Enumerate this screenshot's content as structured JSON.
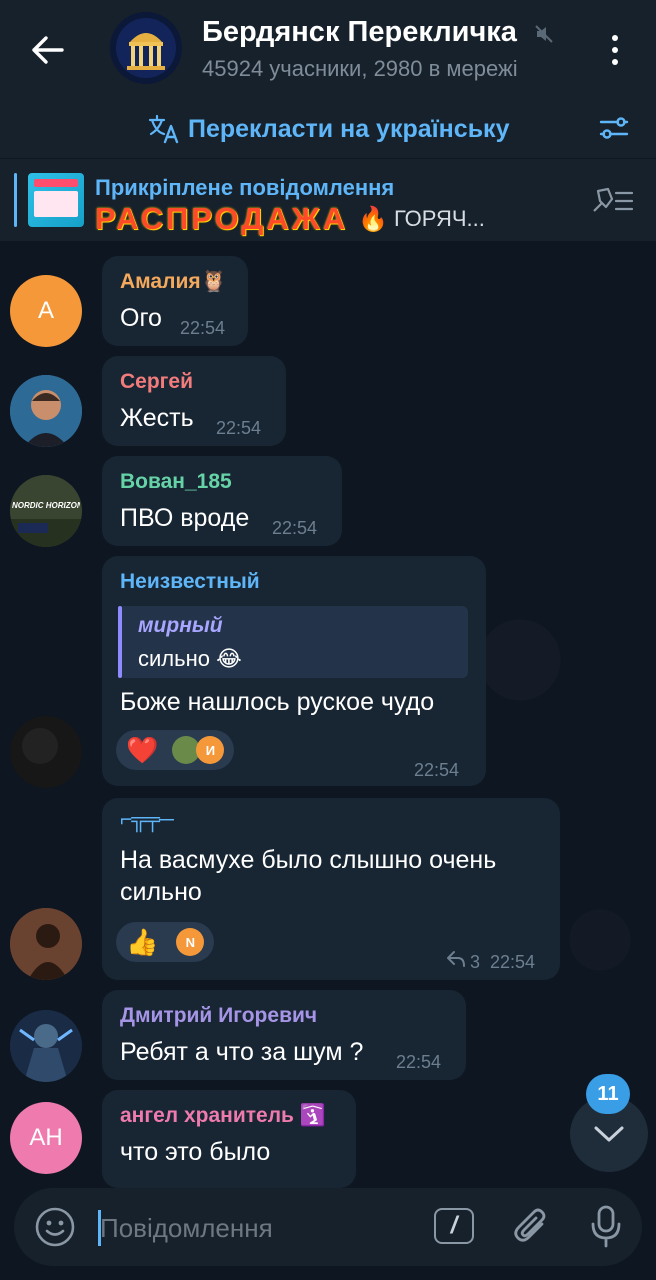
{
  "header": {
    "title": "Бердянск Перекличка",
    "subtitle": "45924 учасники, 2980 в мережі"
  },
  "translate": {
    "label": "Перекласти на українську"
  },
  "pinned": {
    "title": "Прикріплене повідомлення",
    "big_text": "РАСПРОДАЖА",
    "emoji": "🔥",
    "rest": "ГОРЯЧ..."
  },
  "messages": [
    {
      "author": "Амалия🦉",
      "author_color": "#f5a95c",
      "avatar_letter": "А",
      "avatar_color": "#f5983a",
      "text": "Ого",
      "time": "22:54"
    },
    {
      "author": "Сергей",
      "author_color": "#f27c7c",
      "text": "Жесть",
      "time": "22:54"
    },
    {
      "author": "Вован_185",
      "author_color": "#66d3a7",
      "avatar_text": "NORDIC HORIZONS",
      "text": "ПВО вроде",
      "time": "22:54"
    },
    {
      "author": "Неизвестный",
      "author_color": "#5eb5f7",
      "reply": {
        "author": "мирный",
        "text": "сильно 😂"
      },
      "text": "Боже нашлось руское чудо",
      "reactions": {
        "emoji": "❤️",
        "avatar_letter": "И"
      },
      "time": "22:54"
    },
    {
      "author": "⌐╦╤─",
      "author_color": "#5eb5f7",
      "text_lines": [
        "На васмухе было слышно очень",
        "сильно"
      ],
      "reactions": {
        "emoji": "👍",
        "avatar_letter": "N"
      },
      "replies": "3",
      "time": "22:54"
    },
    {
      "author": "Дмитрий Игоревич",
      "author_color": "#a695e7",
      "text": "Ребят а что за шум ?",
      "time": "22:54"
    },
    {
      "author": "ангел хранитель 🛐",
      "author_color": "#ee7aae",
      "avatar_letter": "АН",
      "avatar_color": "#ee7aae",
      "text": "что это было"
    }
  ],
  "scroll_badge": "11",
  "composer": {
    "placeholder": "Повідомлення",
    "command_symbol": "/"
  }
}
